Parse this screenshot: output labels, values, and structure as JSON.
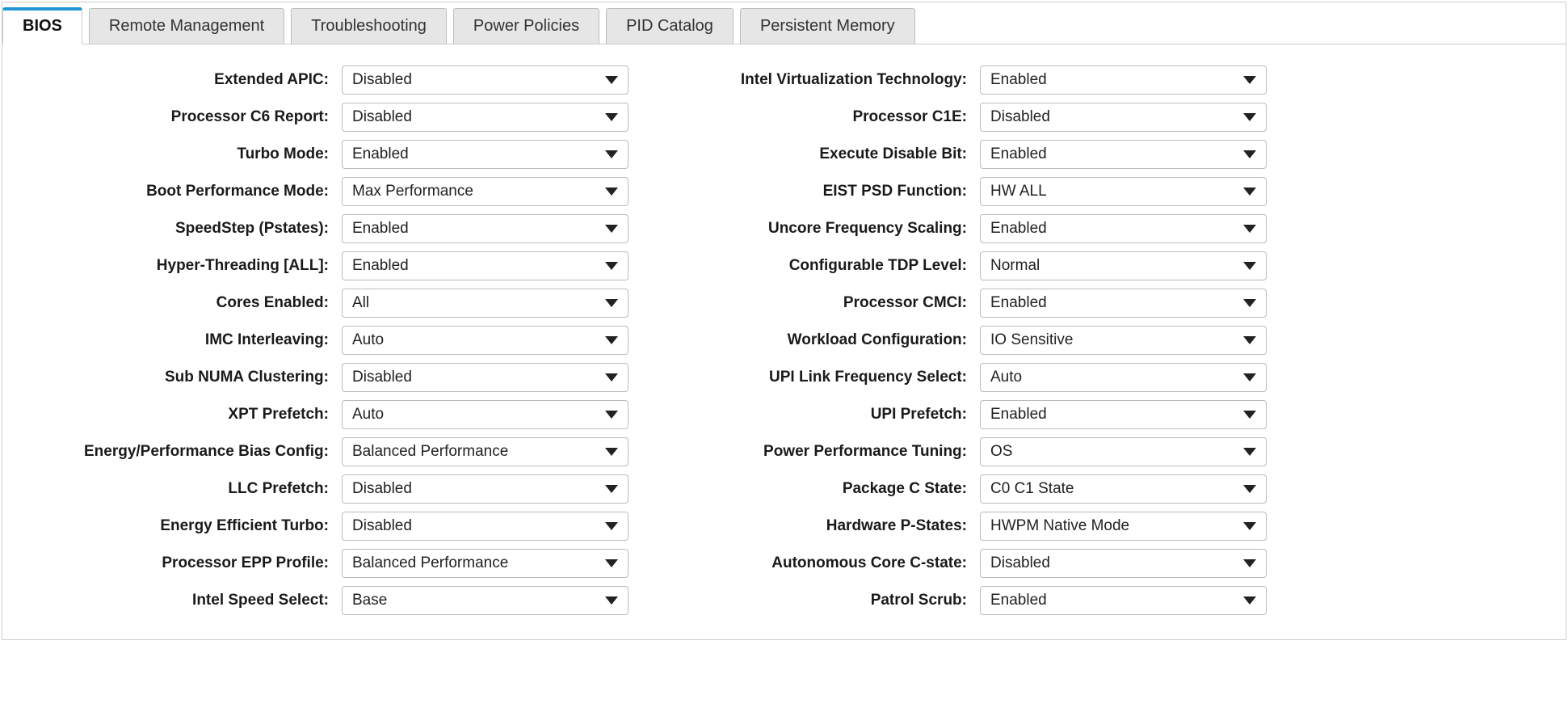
{
  "tabs": [
    {
      "label": "BIOS",
      "active": true
    },
    {
      "label": "Remote Management",
      "active": false
    },
    {
      "label": "Troubleshooting",
      "active": false
    },
    {
      "label": "Power Policies",
      "active": false
    },
    {
      "label": "PID Catalog",
      "active": false
    },
    {
      "label": "Persistent Memory",
      "active": false
    }
  ],
  "left": [
    {
      "label": "Extended APIC:",
      "value": "Disabled"
    },
    {
      "label": "Processor C6 Report:",
      "value": "Disabled"
    },
    {
      "label": "Turbo Mode:",
      "value": "Enabled"
    },
    {
      "label": "Boot Performance Mode:",
      "value": "Max Performance"
    },
    {
      "label": "SpeedStep (Pstates):",
      "value": "Enabled"
    },
    {
      "label": "Hyper-Threading [ALL]:",
      "value": "Enabled"
    },
    {
      "label": "Cores Enabled:",
      "value": "All"
    },
    {
      "label": "IMC Interleaving:",
      "value": "Auto"
    },
    {
      "label": "Sub NUMA Clustering:",
      "value": "Disabled"
    },
    {
      "label": "XPT Prefetch:",
      "value": "Auto"
    },
    {
      "label": "Energy/Performance Bias Config:",
      "value": "Balanced Performance"
    },
    {
      "label": "LLC Prefetch:",
      "value": "Disabled"
    },
    {
      "label": "Energy Efficient Turbo:",
      "value": "Disabled"
    },
    {
      "label": "Processor EPP Profile:",
      "value": "Balanced Performance"
    },
    {
      "label": "Intel Speed Select:",
      "value": "Base"
    }
  ],
  "right": [
    {
      "label": "Intel Virtualization Technology:",
      "value": "Enabled"
    },
    {
      "label": "Processor C1E:",
      "value": "Disabled"
    },
    {
      "label": "Execute Disable Bit:",
      "value": "Enabled"
    },
    {
      "label": "EIST PSD Function:",
      "value": "HW ALL"
    },
    {
      "label": "Uncore Frequency Scaling:",
      "value": "Enabled"
    },
    {
      "label": "Configurable TDP Level:",
      "value": "Normal"
    },
    {
      "label": "Processor CMCI:",
      "value": "Enabled"
    },
    {
      "label": "Workload Configuration:",
      "value": "IO Sensitive"
    },
    {
      "label": "UPI Link Frequency Select:",
      "value": "Auto"
    },
    {
      "label": "UPI Prefetch:",
      "value": "Enabled"
    },
    {
      "label": "Power Performance Tuning:",
      "value": "OS"
    },
    {
      "label": "Package C State:",
      "value": "C0 C1 State"
    },
    {
      "label": "Hardware P-States:",
      "value": "HWPM Native Mode"
    },
    {
      "label": "Autonomous Core C-state:",
      "value": "Disabled"
    },
    {
      "label": "Patrol Scrub:",
      "value": "Enabled"
    }
  ]
}
